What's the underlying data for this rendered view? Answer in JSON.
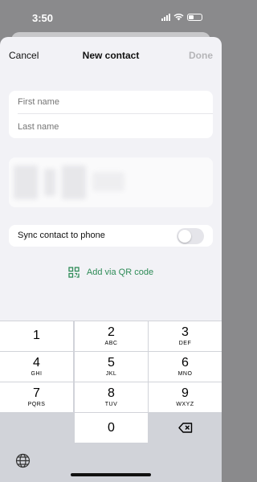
{
  "status": {
    "time": "3:50"
  },
  "nav": {
    "cancel": "Cancel",
    "title": "New contact",
    "done": "Done"
  },
  "form": {
    "first_name_placeholder": "First name",
    "last_name_placeholder": "Last name",
    "sync_label": "Sync contact to phone",
    "sync_enabled": false,
    "qr_label": "Add via QR code"
  },
  "colors": {
    "accent": "#2e8b57",
    "done_disabled": "#b5b5b8",
    "keyboard_bg": "#d1d3d9"
  },
  "keypad": {
    "k1": {
      "num": "1",
      "letters": ""
    },
    "k2": {
      "num": "2",
      "letters": "ABC"
    },
    "k3": {
      "num": "3",
      "letters": "DEF"
    },
    "k4": {
      "num": "4",
      "letters": "GHI"
    },
    "k5": {
      "num": "5",
      "letters": "JKL"
    },
    "k6": {
      "num": "6",
      "letters": "MNO"
    },
    "k7": {
      "num": "7",
      "letters": "PQRS"
    },
    "k8": {
      "num": "8",
      "letters": "TUV"
    },
    "k9": {
      "num": "9",
      "letters": "WXYZ"
    },
    "k0": {
      "num": "0",
      "letters": ""
    }
  },
  "icons": {
    "delete": "backspace-icon",
    "globe": "globe-icon",
    "qr": "qr-code-icon"
  }
}
